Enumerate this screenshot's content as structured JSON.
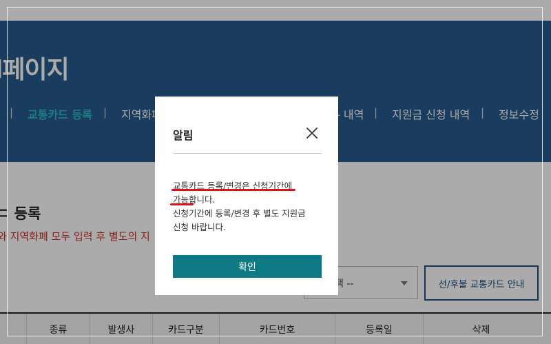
{
  "header": {
    "title": "l페이지",
    "nav": [
      {
        "label": "교통카드 등록",
        "active": true
      },
      {
        "label": "지역화폐"
      },
      {
        "label": "- 내역"
      },
      {
        "label": "지원금 신청 내역"
      },
      {
        "label": "정보수정"
      }
    ],
    "nav_separator": "|"
  },
  "content": {
    "section_title": "ㄷ 등록",
    "notice": "와 지역화폐 모두 입력 후 별도의 지",
    "select_value": "택 --",
    "guide_button": "선/후불 교통카드 안내",
    "table_headers": [
      "종류",
      "발생사",
      "카드구분",
      "카드번호",
      "등록일",
      "삭제"
    ]
  },
  "modal": {
    "title": "알림",
    "lines": [
      "교통카드 등록/변경은 신청기간에",
      "가능합니다.",
      "신청기간에 등록/변경 후 별도 지원금",
      "신청 바랍니다."
    ],
    "confirm_label": "확인"
  },
  "colors": {
    "header_band": "#285a8c",
    "active_nav": "#2fb8c4",
    "notice_text": "#c8322c",
    "confirm_button": "#0f7a83",
    "annotation_underline": "#d9141f"
  },
  "icons": {
    "close": "close-icon",
    "select_caret": "chevron-down-icon"
  }
}
